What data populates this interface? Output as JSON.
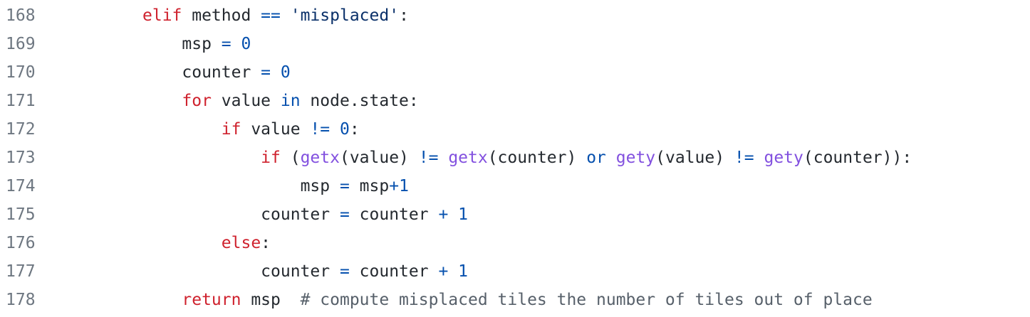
{
  "lines": [
    {
      "number": "168",
      "indent": "",
      "tokens": [
        {
          "t": "elif",
          "c": "kw"
        },
        {
          "t": " method ",
          "c": "plain"
        },
        {
          "t": "==",
          "c": "op"
        },
        {
          "t": " ",
          "c": "plain"
        },
        {
          "t": "'misplaced'",
          "c": "str"
        },
        {
          "t": ":",
          "c": "plain"
        }
      ]
    },
    {
      "number": "169",
      "indent": "    ",
      "tokens": [
        {
          "t": "msp ",
          "c": "plain"
        },
        {
          "t": "=",
          "c": "op"
        },
        {
          "t": " ",
          "c": "plain"
        },
        {
          "t": "0",
          "c": "num"
        }
      ]
    },
    {
      "number": "170",
      "indent": "    ",
      "tokens": [
        {
          "t": "counter ",
          "c": "plain"
        },
        {
          "t": "=",
          "c": "op"
        },
        {
          "t": " ",
          "c": "plain"
        },
        {
          "t": "0",
          "c": "num"
        }
      ]
    },
    {
      "number": "171",
      "indent": "    ",
      "tokens": [
        {
          "t": "for",
          "c": "kw"
        },
        {
          "t": " value ",
          "c": "plain"
        },
        {
          "t": "in",
          "c": "op"
        },
        {
          "t": " node.state:",
          "c": "plain"
        }
      ]
    },
    {
      "number": "172",
      "indent": "        ",
      "tokens": [
        {
          "t": "if",
          "c": "kw"
        },
        {
          "t": " value ",
          "c": "plain"
        },
        {
          "t": "!=",
          "c": "op"
        },
        {
          "t": " ",
          "c": "plain"
        },
        {
          "t": "0",
          "c": "num"
        },
        {
          "t": ":",
          "c": "plain"
        }
      ]
    },
    {
      "number": "173",
      "indent": "            ",
      "tokens": [
        {
          "t": "if",
          "c": "kw"
        },
        {
          "t": " (",
          "c": "plain"
        },
        {
          "t": "getx",
          "c": "fn"
        },
        {
          "t": "(value) ",
          "c": "plain"
        },
        {
          "t": "!=",
          "c": "op"
        },
        {
          "t": " ",
          "c": "plain"
        },
        {
          "t": "getx",
          "c": "fn"
        },
        {
          "t": "(counter) ",
          "c": "plain"
        },
        {
          "t": "or",
          "c": "op"
        },
        {
          "t": " ",
          "c": "plain"
        },
        {
          "t": "gety",
          "c": "fn"
        },
        {
          "t": "(value) ",
          "c": "plain"
        },
        {
          "t": "!=",
          "c": "op"
        },
        {
          "t": " ",
          "c": "plain"
        },
        {
          "t": "gety",
          "c": "fn"
        },
        {
          "t": "(counter)):",
          "c": "plain"
        }
      ]
    },
    {
      "number": "174",
      "indent": "                ",
      "tokens": [
        {
          "t": "msp ",
          "c": "plain"
        },
        {
          "t": "=",
          "c": "op"
        },
        {
          "t": " msp",
          "c": "plain"
        },
        {
          "t": "+",
          "c": "op"
        },
        {
          "t": "1",
          "c": "num"
        }
      ]
    },
    {
      "number": "175",
      "indent": "            ",
      "tokens": [
        {
          "t": "counter ",
          "c": "plain"
        },
        {
          "t": "=",
          "c": "op"
        },
        {
          "t": " counter ",
          "c": "plain"
        },
        {
          "t": "+",
          "c": "op"
        },
        {
          "t": " ",
          "c": "plain"
        },
        {
          "t": "1",
          "c": "num"
        }
      ]
    },
    {
      "number": "176",
      "indent": "        ",
      "tokens": [
        {
          "t": "else",
          "c": "kw"
        },
        {
          "t": ":",
          "c": "plain"
        }
      ]
    },
    {
      "number": "177",
      "indent": "            ",
      "tokens": [
        {
          "t": "counter ",
          "c": "plain"
        },
        {
          "t": "=",
          "c": "op"
        },
        {
          "t": " counter ",
          "c": "plain"
        },
        {
          "t": "+",
          "c": "op"
        },
        {
          "t": " ",
          "c": "plain"
        },
        {
          "t": "1",
          "c": "num"
        }
      ]
    },
    {
      "number": "178",
      "indent": "    ",
      "tokens": [
        {
          "t": "return",
          "c": "kw"
        },
        {
          "t": " msp  ",
          "c": "plain"
        },
        {
          "t": "# compute misplaced tiles the number of tiles out of place",
          "c": "cm"
        }
      ]
    }
  ],
  "colors": {
    "keyword": "#cf222e",
    "number": "#0550ae",
    "operator": "#0550ae",
    "string": "#0a3069",
    "function": "#8250df",
    "comment": "#57606a",
    "line_number": "#6e7781",
    "text": "#24292f"
  }
}
